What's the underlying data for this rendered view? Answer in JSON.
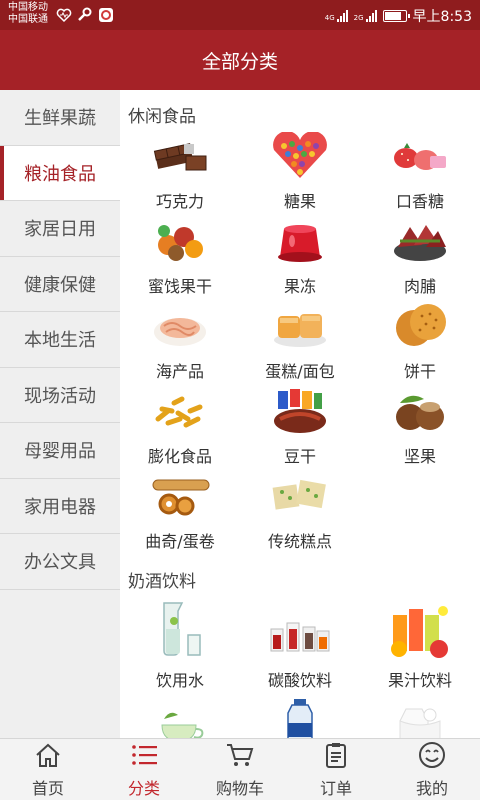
{
  "status": {
    "carrier1": "中国移动",
    "carrier2": "中国联通",
    "net1": "4G",
    "net2": "2G",
    "time": "早上8:53",
    "battery_level": 0.85
  },
  "header": {
    "title": "全部分类"
  },
  "sidebar": {
    "items": [
      {
        "label": "生鲜果蔬"
      },
      {
        "label": "粮油食品"
      },
      {
        "label": "家居日用"
      },
      {
        "label": "健康保健"
      },
      {
        "label": "本地生活"
      },
      {
        "label": "现场活动"
      },
      {
        "label": "母婴用品"
      },
      {
        "label": "家用电器"
      },
      {
        "label": "办公文具"
      }
    ],
    "active_index": 1
  },
  "content": {
    "sections": [
      {
        "title": "休闲食品",
        "items": [
          {
            "label": "巧克力",
            "icon": "chocolate-icon"
          },
          {
            "label": "糖果",
            "icon": "candy-heart-icon"
          },
          {
            "label": "口香糖",
            "icon": "gum-icon"
          },
          {
            "label": "蜜饯果干",
            "icon": "dried-fruit-icon"
          },
          {
            "label": "果冻",
            "icon": "jelly-icon"
          },
          {
            "label": "肉脯",
            "icon": "jerky-icon"
          },
          {
            "label": "海产品",
            "icon": "seafood-icon"
          },
          {
            "label": "蛋糕/面包",
            "icon": "cake-icon"
          },
          {
            "label": "饼干",
            "icon": "biscuit-icon"
          },
          {
            "label": "膨化食品",
            "icon": "puffed-snack-icon"
          },
          {
            "label": "豆干",
            "icon": "tofu-snack-icon"
          },
          {
            "label": "坚果",
            "icon": "nut-icon"
          },
          {
            "label": "曲奇/蛋卷",
            "icon": "cookie-roll-icon"
          },
          {
            "label": "传统糕点",
            "icon": "pastry-icon"
          }
        ]
      },
      {
        "title": "奶酒饮料",
        "items": [
          {
            "label": "饮用水",
            "icon": "water-pitcher-icon"
          },
          {
            "label": "碳酸饮料",
            "icon": "soda-icon"
          },
          {
            "label": "果汁饮料",
            "icon": "juice-icon"
          },
          {
            "label": "",
            "icon": "tea-icon"
          },
          {
            "label": "",
            "icon": "drink-bottle-icon"
          },
          {
            "label": "",
            "icon": "milk-icon"
          }
        ]
      }
    ]
  },
  "tabbar": {
    "items": [
      {
        "label": "首页",
        "icon": "home-icon"
      },
      {
        "label": "分类",
        "icon": "list-icon"
      },
      {
        "label": "购物车",
        "icon": "cart-icon"
      },
      {
        "label": "订单",
        "icon": "order-icon"
      },
      {
        "label": "我的",
        "icon": "smile-icon"
      }
    ],
    "active_index": 1
  },
  "colors": {
    "brand": "#a52227",
    "status": "#8f1c1e",
    "tab_active": "#c2272d"
  }
}
